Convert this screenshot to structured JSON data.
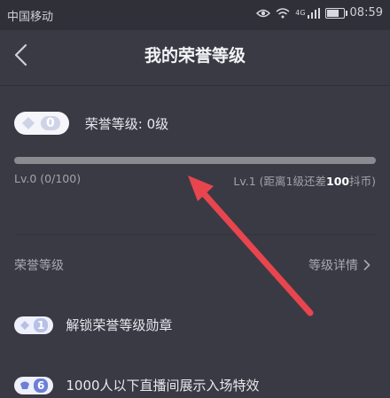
{
  "status_bar": {
    "carrier": "中国移动",
    "network": "4G",
    "time": "08:59",
    "battery_level": 0.8
  },
  "nav": {
    "title": "我的荣誉等级"
  },
  "honor": {
    "badge_level": "0",
    "level_label": "荣誉等级: 0级",
    "progress_fraction": 0,
    "left_label": "Lv.0 (0/100)",
    "right_prefix": "Lv.1 (距离1级还差",
    "right_amount": "100",
    "right_suffix": "抖币)"
  },
  "section": {
    "title": "荣誉等级",
    "details_label": "等级详情"
  },
  "perks": [
    {
      "level": "1",
      "text": "解锁荣誉等级勋章"
    },
    {
      "level": "6",
      "text": "1000人以下直播间展示入场特效"
    }
  ],
  "colors": {
    "background": "#3a3a44",
    "annotation_arrow": "#e8454f"
  }
}
